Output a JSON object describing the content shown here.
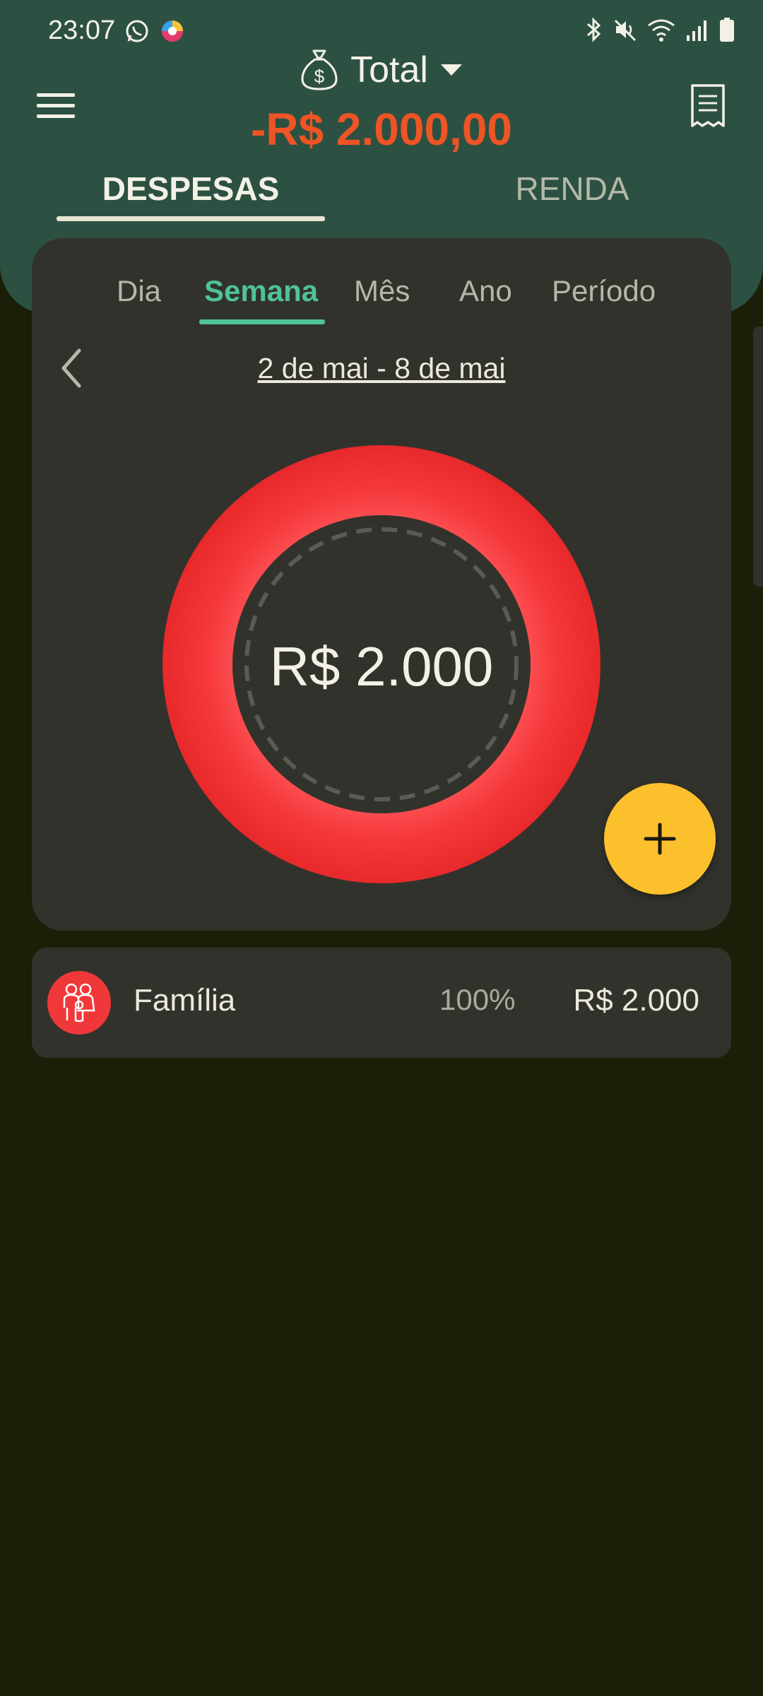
{
  "status_bar": {
    "time": "23:07",
    "left_icons": [
      "whatsapp-icon",
      "browser-icon"
    ],
    "right_icons": [
      "bluetooth-icon",
      "mute-icon",
      "wifi-icon",
      "signal-icon",
      "battery-icon"
    ]
  },
  "header": {
    "account_name": "Total",
    "total_amount": "-R$ 2.000,00",
    "tabs": [
      {
        "label": "DESPESAS",
        "active": true
      },
      {
        "label": "RENDA",
        "active": false
      }
    ]
  },
  "period_tabs": [
    {
      "label": "Dia",
      "active": false
    },
    {
      "label": "Semana",
      "active": true
    },
    {
      "label": "Mês",
      "active": false
    },
    {
      "label": "Ano",
      "active": false
    },
    {
      "label": "Período",
      "active": false
    }
  ],
  "date_range": "2 de mai - 8 de mai",
  "chart": {
    "center_label": "R$ 2.000"
  },
  "chart_data": {
    "type": "pie",
    "categories": [
      "Família"
    ],
    "values": [
      2000
    ],
    "colors": [
      "#f0383a"
    ]
  },
  "categories": [
    {
      "name": "Família",
      "percent": "100%",
      "amount": "R$ 2.000",
      "icon": "family-icon",
      "color": "#f0383a"
    }
  ],
  "colors": {
    "header": "#2c5142",
    "accent_green": "#4fc395",
    "expense_red": "#ee5425",
    "fab_yellow": "#fcc02d",
    "card": "#32322c",
    "background": "#1b1f07"
  }
}
